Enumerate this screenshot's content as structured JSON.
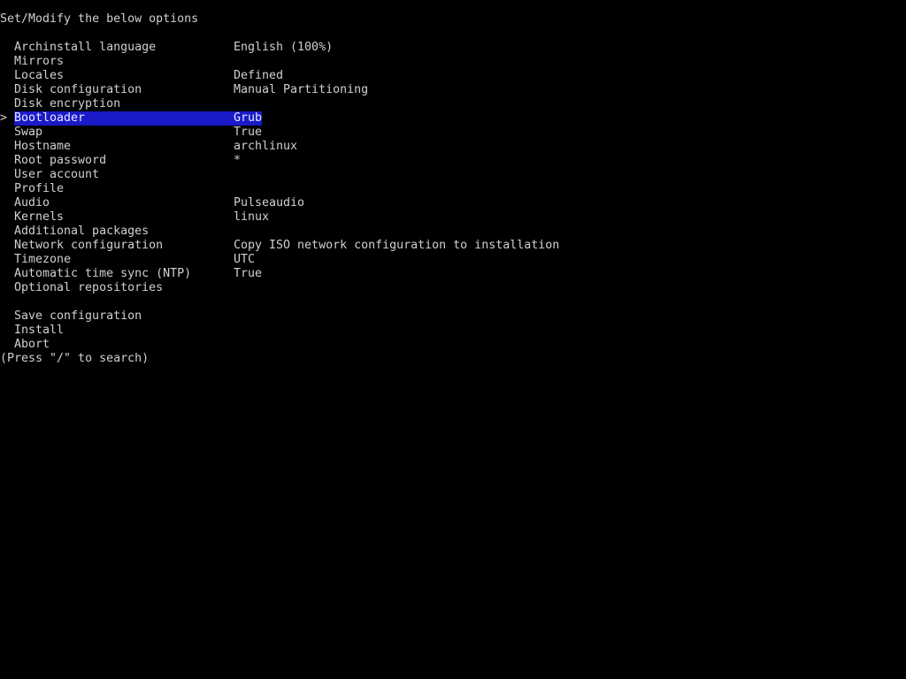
{
  "header": "Set/Modify the below options",
  "cursor_glyph": ">",
  "selected_index": 5,
  "highlight_color": "#1a1ac8",
  "options": [
    {
      "label": "Archinstall language",
      "value": "English (100%)"
    },
    {
      "label": "Mirrors",
      "value": ""
    },
    {
      "label": "Locales",
      "value": "Defined"
    },
    {
      "label": "Disk configuration",
      "value": "Manual Partitioning"
    },
    {
      "label": "Disk encryption",
      "value": ""
    },
    {
      "label": "Bootloader",
      "value": "Grub"
    },
    {
      "label": "Swap",
      "value": "True"
    },
    {
      "label": "Hostname",
      "value": "archlinux"
    },
    {
      "label": "Root password",
      "value": "*"
    },
    {
      "label": "User account",
      "value": ""
    },
    {
      "label": "Profile",
      "value": ""
    },
    {
      "label": "Audio",
      "value": "Pulseaudio"
    },
    {
      "label": "Kernels",
      "value": "linux"
    },
    {
      "label": "Additional packages",
      "value": ""
    },
    {
      "label": "Network configuration",
      "value": "Copy ISO network configuration to installation"
    },
    {
      "label": "Timezone",
      "value": "UTC"
    },
    {
      "label": "Automatic time sync (NTP)",
      "value": "True"
    },
    {
      "label": "Optional repositories",
      "value": ""
    }
  ],
  "actions": [
    {
      "label": "Save configuration"
    },
    {
      "label": "Install"
    },
    {
      "label": "Abort"
    }
  ],
  "footer": "(Press \"/\" to search)"
}
